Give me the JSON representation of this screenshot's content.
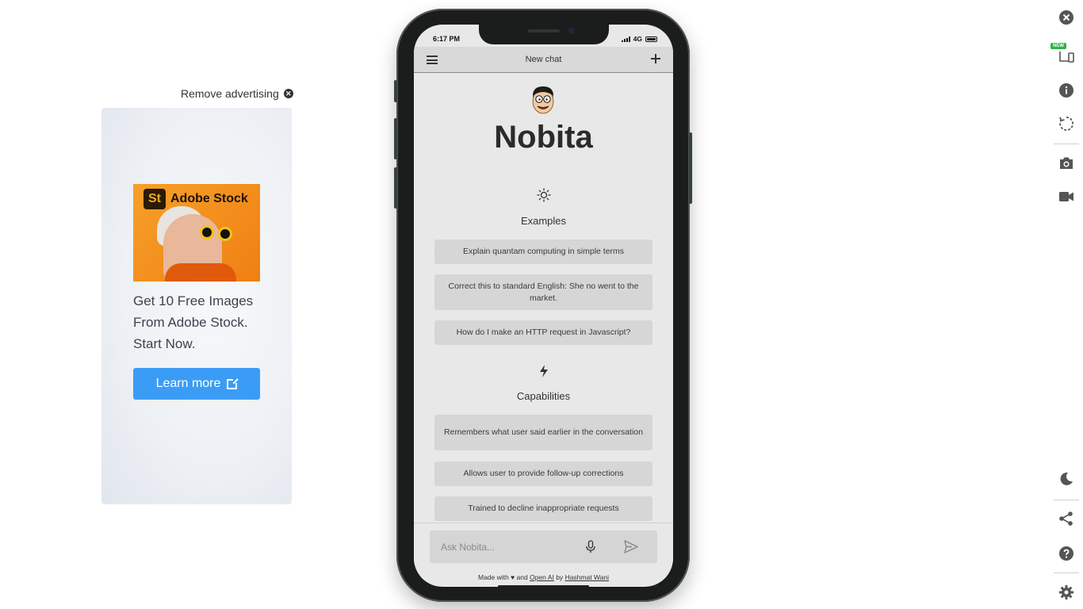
{
  "ad": {
    "remove_label": "Remove advertising",
    "brand_badge": "St",
    "brand_name": "Adobe Stock",
    "text_line1": "Get 10 Free Images",
    "text_line2": "From Adobe Stock.",
    "text_line3": "Start Now.",
    "button_label": "Learn more",
    "button_color": "#3b9cf5"
  },
  "phone": {
    "status_time": "6:17 PM",
    "network": "4G",
    "header_title": "New chat",
    "app_title": "Nobita",
    "examples": {
      "icon": "sun-icon",
      "title": "Examples",
      "items": [
        "Explain quantam computing in simple terms",
        "Correct this to standard English: She no went to the market.",
        "How do I make an HTTP request in Javascript?"
      ]
    },
    "capabilities": {
      "icon": "lightning-icon",
      "title": "Capabilities",
      "items": [
        "Remembers what user said earlier in the conversation",
        "Allows user to provide follow-up corrections",
        "Trained to decline inappropriate requests"
      ]
    },
    "input_placeholder": "Ask Nobita...",
    "footer": {
      "made_with": "Made with",
      "and": "and",
      "openai_link": "Open AI",
      "by": "by",
      "author_link": "Hashmat Wani"
    }
  },
  "toolbar": {
    "new_badge": "NEW",
    "items": [
      "close-icon",
      "devices-icon",
      "info-icon",
      "rotate-icon",
      "camera-icon",
      "video-icon",
      "moon-icon",
      "share-icon",
      "help-icon",
      "settings-icon"
    ]
  }
}
